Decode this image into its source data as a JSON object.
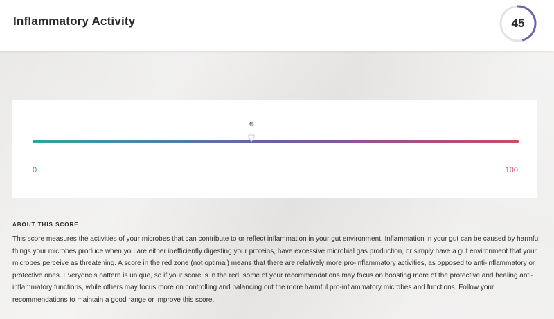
{
  "header": {
    "title": "Inflammatory Activity",
    "score": "45",
    "score_fraction": 0.45,
    "ring_color": "#7063a9"
  },
  "scale": {
    "value": 45,
    "value_label": "45",
    "min_label": "0",
    "max_label": "100",
    "min": 0,
    "max": 100,
    "gradient_start": "#2fa3a0",
    "gradient_end": "#c84d62"
  },
  "about": {
    "heading": "ABOUT THIS SCORE",
    "body": "This score measures the activities of your microbes that can contribute to or reflect inflammation in your gut environment. Inflammation in your gut can be caused by harmful things your microbes produce when you are either inefficiently digesting your proteins, have excessive microbial gas production, or simply have a gut environment that your microbes perceive as threatening. A score in the red zone (not optimal) means that there are relatively more pro-inflammatory activities, as opposed to anti-inflammatory or protective ones. Everyone's pattern is unique, so if your score is in the red, some of your recommendations may focus on boosting more of the protective and healing anti-inflammatory functions, while others may focus more on controlling and balancing out the more harmful pro-inflammatory microbes and functions. Follow your recommendations to maintain a good range or improve this score."
  }
}
